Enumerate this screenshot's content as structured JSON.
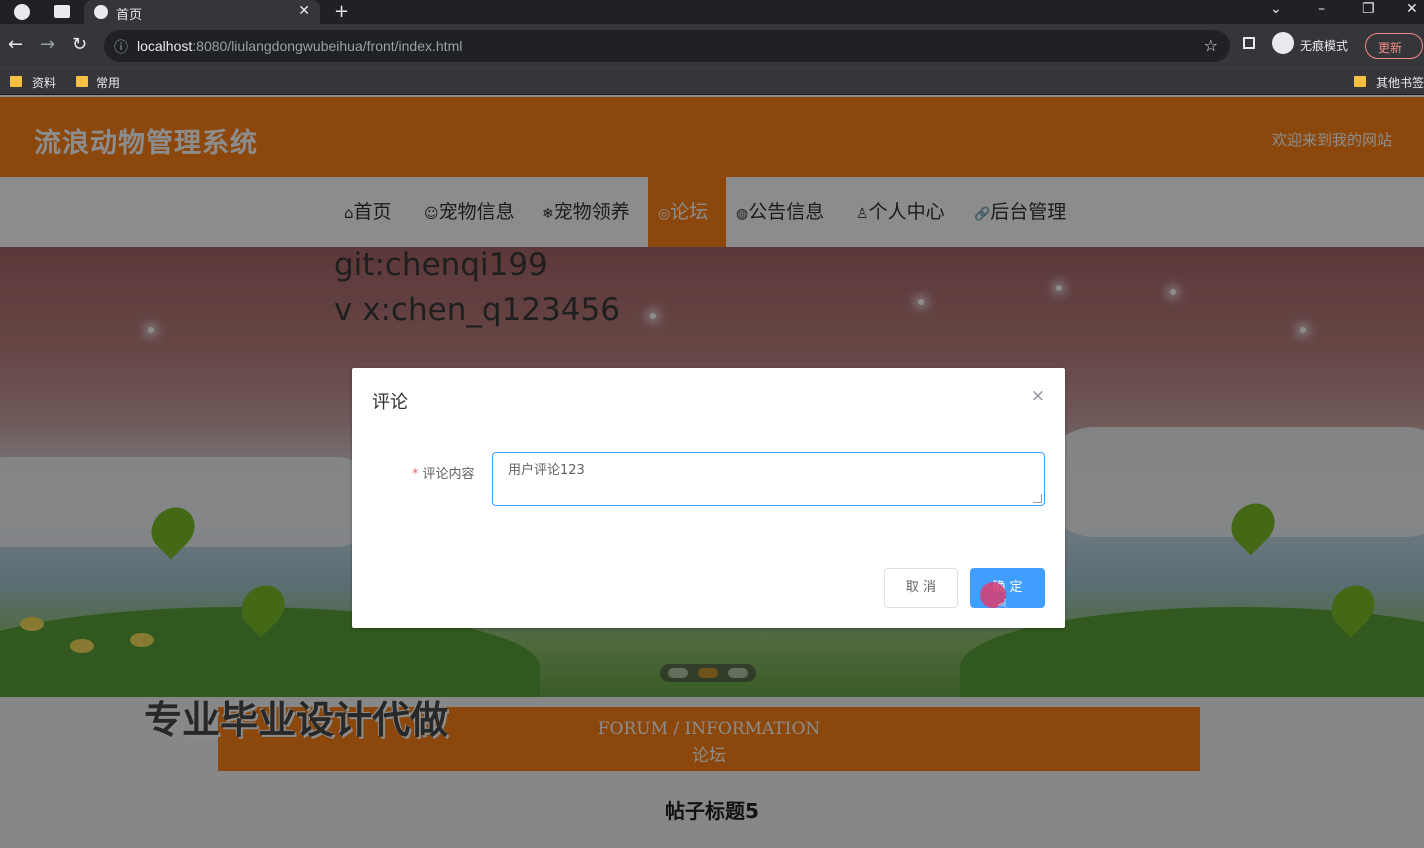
{
  "browser": {
    "tab_title": "首页",
    "tab_close": "✕",
    "new_tab": "+",
    "url_host": "localhost",
    "url_rest": ":8080/liulangdongwubeihua/front/index.html",
    "incognito_label": "无痕模式",
    "update_label": "更新",
    "bookmarks": [
      "资料",
      "常用"
    ],
    "other_bookmarks": "其他书签"
  },
  "site": {
    "title": "流浪动物管理系统",
    "welcome": "欢迎来到我的网站"
  },
  "nav": {
    "items": [
      {
        "icon": "⌂",
        "label": "首页"
      },
      {
        "icon": "☺",
        "label": "宠物信息"
      },
      {
        "icon": "❄",
        "label": "宠物领养"
      },
      {
        "icon": "◎",
        "label": "论坛"
      },
      {
        "icon": "◍",
        "label": "公告信息"
      },
      {
        "icon": "♙",
        "label": "个人中心"
      },
      {
        "icon": "🔗",
        "label": "后台管理"
      }
    ],
    "active": "论坛"
  },
  "watermark": {
    "line1": "git:chenqi199",
    "line2": "v x:chen_q123456"
  },
  "promo": "专业毕业设计代做",
  "forum": {
    "en": "FORUM / INFORMATION",
    "cn": "论坛",
    "post_title": "帖子标题5"
  },
  "dialog": {
    "title": "评论",
    "close": "×",
    "field_label": "评论内容",
    "required_mark": "*",
    "textarea_value": "用户评论123",
    "cancel_label": "取 消",
    "confirm_label": "确 定"
  },
  "colors": {
    "brand": "#ff8316",
    "primary": "#409eff"
  }
}
